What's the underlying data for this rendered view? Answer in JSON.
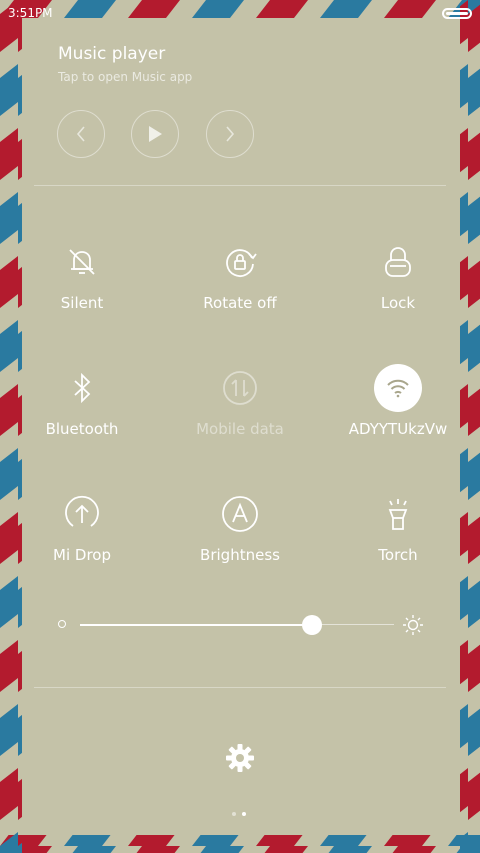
{
  "status_bar": {
    "time": "3:51PM"
  },
  "music": {
    "title": "Music player",
    "subtitle": "Tap to open Music app"
  },
  "tiles": [
    {
      "label": "Silent",
      "icon": "bell-off-icon",
      "active": false,
      "dimmed": false
    },
    {
      "label": "Rotate off",
      "icon": "rotation-lock-icon",
      "active": false,
      "dimmed": false
    },
    {
      "label": "Lock",
      "icon": "lock-icon",
      "active": false,
      "dimmed": false
    },
    {
      "label": "Bluetooth",
      "icon": "bluetooth-icon",
      "active": false,
      "dimmed": false
    },
    {
      "label": "Mobile data",
      "icon": "mobile-data-icon",
      "active": false,
      "dimmed": true
    },
    {
      "label": "ADYYTUkzVw",
      "icon": "wifi-icon",
      "active": true,
      "dimmed": false
    },
    {
      "label": "Mi Drop",
      "icon": "mi-drop-icon",
      "active": false,
      "dimmed": false
    },
    {
      "label": "Brightness",
      "icon": "auto-brightness-icon",
      "active": false,
      "dimmed": false
    },
    {
      "label": "Torch",
      "icon": "torch-icon",
      "active": false,
      "dimmed": false
    }
  ],
  "brightness": {
    "level": 0.74
  },
  "pager": {
    "pages": 2,
    "current": 2
  },
  "colors": {
    "background": "#c4c2a8",
    "stripe_red": "#b31b2e",
    "stripe_blue": "#2a7aa0"
  }
}
